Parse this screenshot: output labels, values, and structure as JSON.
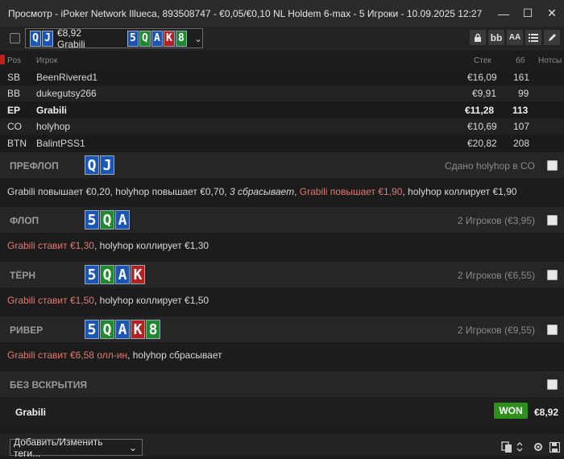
{
  "window": {
    "title": "Просмотр - iPoker Network Illueca, 893508747 - €0,05/€0,10 NL Holdem 6-max  - 5 Игроки - 10.09.2025 12:27",
    "minimize": "—",
    "maximize": "☐",
    "close": "✕"
  },
  "toolbar": {
    "hand_cards": [
      "Q",
      "J"
    ],
    "hand_label": "€8,92 Grabili",
    "board": [
      "5",
      "Q",
      "A",
      "K",
      "8"
    ],
    "dropdown_arrow": "⌄",
    "bb_label": "bb",
    "font_label": "AA",
    "icons": [
      "lock-icon",
      "bb-icon",
      "font-size-icon",
      "list-icon",
      "pencil-icon"
    ]
  },
  "table": {
    "headers": {
      "pos": "Pos",
      "player": "Игрок",
      "stack": "Стек",
      "bb": "бб",
      "notes": "Нотсы"
    },
    "rows": [
      {
        "pos": "SB",
        "player": "BeenRivered1",
        "stack": "€16,09",
        "bb": "161",
        "hero": false
      },
      {
        "pos": "BB",
        "player": "dukegutsy266",
        "stack": "€9,91",
        "bb": "99",
        "hero": false
      },
      {
        "pos": "EP",
        "player": "Grabili",
        "stack": "€11,28",
        "bb": "113",
        "hero": true
      },
      {
        "pos": "CO",
        "player": "holyhop",
        "stack": "€10,69",
        "bb": "107",
        "hero": false
      },
      {
        "pos": "BTN",
        "player": "BalintPSS1",
        "stack": "€20,82",
        "bb": "208",
        "hero": false
      }
    ]
  },
  "streets": {
    "preflop": {
      "title": "ПРЕФЛОП",
      "cards": [
        "Q",
        "J"
      ],
      "right": "Сдано holyhop в CO",
      "action": {
        "a": "Grabili повышает €0,20, holyhop повышает €0,70, ",
        "b": "3 сбрасывает",
        "c": ", ",
        "d": "Grabili повышает €1,90",
        "e": ", holyhop коллирует €1,90"
      }
    },
    "flop": {
      "title": "ФЛОП",
      "cards": [
        "5",
        "Q",
        "A"
      ],
      "right": "2 Игроков (€3,95)",
      "action": {
        "a": "Grabili ставит €1,30",
        "b": ", holyhop коллирует €1,30"
      }
    },
    "turn": {
      "title": "ТЁРН",
      "cards": [
        "5",
        "Q",
        "A",
        "K"
      ],
      "right": "2 Игроков (€6,55)",
      "action": {
        "a": "Grabili ставит €1,50",
        "b": ", holyhop коллирует €1,50"
      }
    },
    "river": {
      "title": "РИВЕР",
      "cards": [
        "5",
        "Q",
        "A",
        "K",
        "8"
      ],
      "right": "2 Игроков (€9,55)",
      "action": {
        "a": "Grabili ставит €6,58 олл-ин",
        "b": ", holyhop сбрасывает"
      }
    },
    "showdown": {
      "title": "БЕЗ ВСКРЫТИЯ"
    }
  },
  "result": {
    "player": "Grabili",
    "badge": "WON",
    "amount": "€8,92"
  },
  "footer": {
    "tags_label": "Добавить/Изменить теги...",
    "tags_arrow": "⌄"
  },
  "colors": {
    "spade": "#1a55b8",
    "club": "#1d8a2e",
    "heart": "#b52121",
    "won": "#2f8f1e",
    "raise": "#e07a74"
  }
}
